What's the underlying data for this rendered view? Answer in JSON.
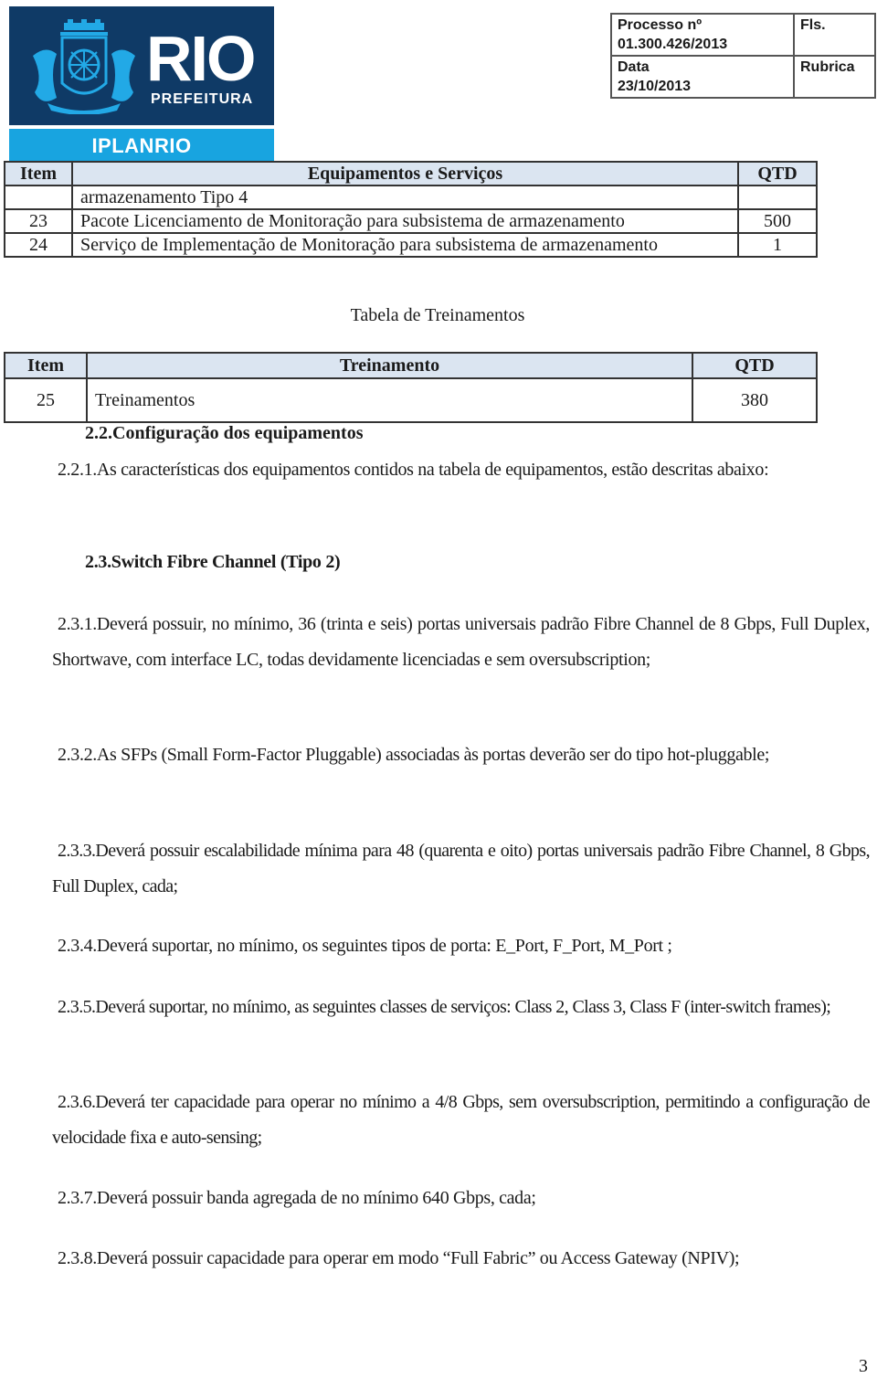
{
  "header": {
    "logo": {
      "main_text": "RIO",
      "sub_text": "PREFEITURA",
      "band_text": "IPLANRIO",
      "icon": "coat-of-arms-icon",
      "colors": {
        "dark_blue": "#0f3a66",
        "light_blue": "#18a4e0"
      }
    },
    "process_box": {
      "processo_label": "Processo nº",
      "processo_value": "01.300.426/2013",
      "fls_label": "Fls.",
      "data_label": "Data",
      "data_value": "23/10/2013",
      "rubrica_label": "Rubrica"
    }
  },
  "equipment_table": {
    "columns": [
      "Item",
      "Equipamentos e Serviços",
      "QTD"
    ],
    "rows": [
      {
        "item": "",
        "description": "armazenamento Tipo 4",
        "qtd": ""
      },
      {
        "item": "23",
        "description": "Pacote Licenciamento de Monitoração para subsistema de armazenamento",
        "qtd": "500"
      },
      {
        "item": "24",
        "description": "Serviço de Implementação de Monitoração para subsistema de armazenamento",
        "qtd": "1"
      }
    ]
  },
  "training_table": {
    "caption": "Tabela de Treinamentos",
    "columns": [
      "Item",
      "Treinamento",
      "QTD"
    ],
    "rows": [
      {
        "item": "25",
        "description": "Treinamentos",
        "qtd": "380"
      }
    ]
  },
  "sections": {
    "s22_heading": "2.2.Configuração dos equipamentos",
    "s221": "2.2.1.As características dos equipamentos contidos na tabela de equipamentos, estão descritas abaixo:",
    "s23_heading": "2.3.Switch Fibre Channel  (Tipo 2)",
    "items": [
      "2.3.1.Deverá possuir, no mínimo, 36 (trinta e seis) portas universais padrão Fibre Channel de 8 Gbps, Full Duplex, Shortwave, com interface LC, todas devidamente licenciadas e sem oversubscription;",
      "2.3.2.As SFPs (Small Form-Factor Pluggable) associadas às portas deverão ser do tipo hot-pluggable;",
      "2.3.3.Deverá possuir escalabilidade mínima para 48 (quarenta e oito) portas universais padrão Fibre Channel, 8 Gbps, Full Duplex, cada;",
      "2.3.4.Deverá suportar, no mínimo, os seguintes tipos de porta: E_Port, F_Port, M_Port ;",
      "2.3.5.Deverá suportar, no mínimo, as seguintes classes de serviços: Class 2, Class 3, Class F (inter-switch frames);",
      "2.3.6.Deverá ter capacidade para operar no mínimo a 4/8 Gbps, sem oversubscription, permitindo a configuração de velocidade fixa e auto-sensing;",
      "2.3.7.Deverá possuir banda agregada de no mínimo 640 Gbps, cada;",
      "2.3.8.Deverá possuir capacidade para operar em modo “Full Fabric” ou Access Gateway (NPIV);"
    ]
  },
  "footer": {
    "page_number": "3"
  }
}
